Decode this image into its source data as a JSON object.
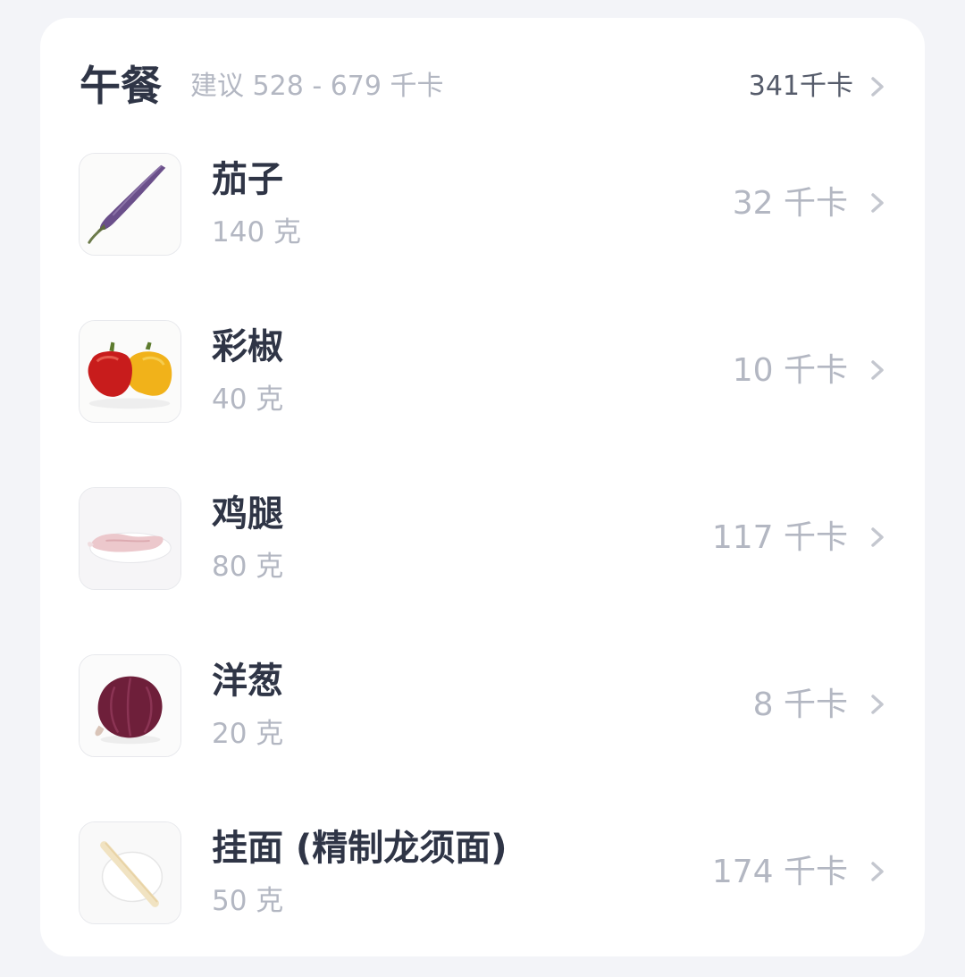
{
  "meal": {
    "title": "午餐",
    "suggestion": "建议 528 - 679 千卡",
    "total": "341千卡"
  },
  "foods": [
    {
      "name": "茄子",
      "amount": "140 克",
      "kcal": "32 千卡",
      "image": "eggplant"
    },
    {
      "name": "彩椒",
      "amount": "40 克",
      "kcal": "10 千卡",
      "image": "bell-peppers"
    },
    {
      "name": "鸡腿",
      "amount": "80 克",
      "kcal": "117 千卡",
      "image": "chicken-leg"
    },
    {
      "name": "洋葱",
      "amount": "20 克",
      "kcal": "8 千卡",
      "image": "red-onion"
    },
    {
      "name": "挂面 (精制龙须面)",
      "amount": "50 克",
      "kcal": "174 千卡",
      "image": "noodles"
    }
  ],
  "colors": {
    "background": "#f3f4f8",
    "card": "#ffffff",
    "title_text": "#2f3546",
    "muted_text": "#b3b7c2",
    "chevron": "#c4c7cf"
  }
}
